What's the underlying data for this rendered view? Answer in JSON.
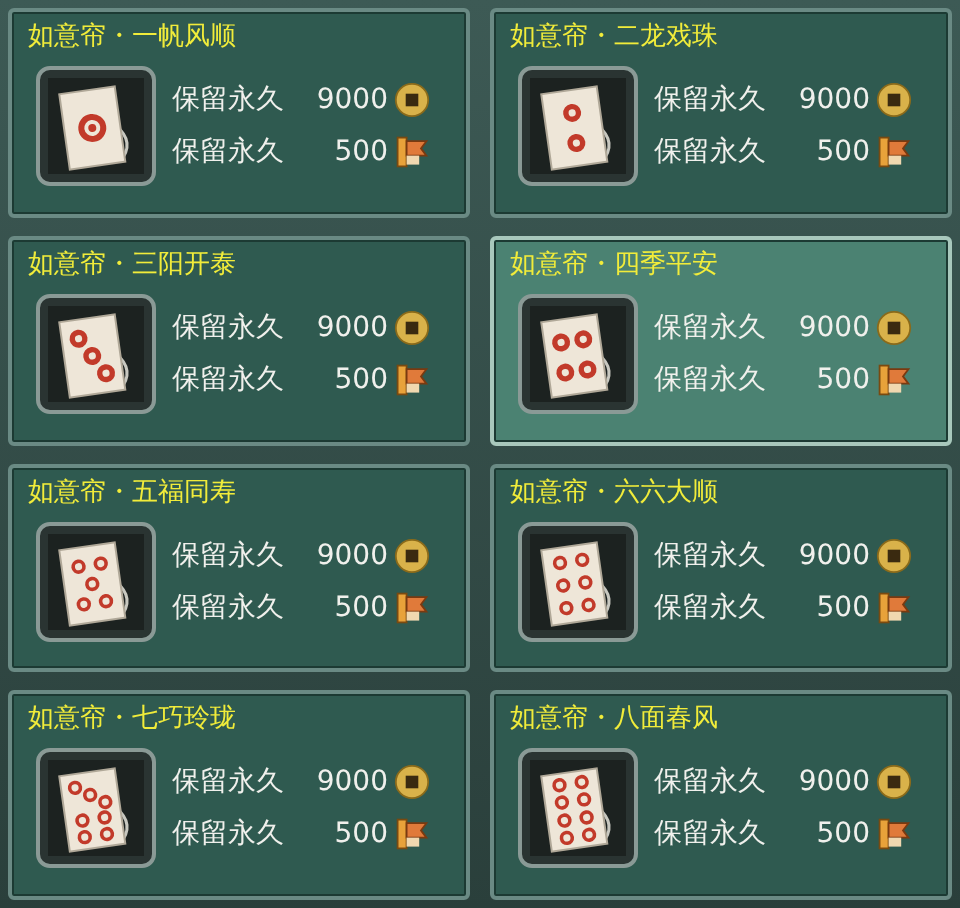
{
  "items": [
    {
      "title": "如意帘・一帆风顺",
      "selected": false,
      "prices": [
        {
          "label": "保留永久",
          "amount": "9000",
          "kind": "coin"
        },
        {
          "label": "保留永久",
          "amount": "500",
          "kind": "token"
        }
      ]
    },
    {
      "title": "如意帘・二龙戏珠",
      "selected": false,
      "prices": [
        {
          "label": "保留永久",
          "amount": "9000",
          "kind": "coin"
        },
        {
          "label": "保留永久",
          "amount": "500",
          "kind": "token"
        }
      ]
    },
    {
      "title": "如意帘・三阳开泰",
      "selected": false,
      "prices": [
        {
          "label": "保留永久",
          "amount": "9000",
          "kind": "coin"
        },
        {
          "label": "保留永久",
          "amount": "500",
          "kind": "token"
        }
      ]
    },
    {
      "title": "如意帘・四季平安",
      "selected": true,
      "prices": [
        {
          "label": "保留永久",
          "amount": "9000",
          "kind": "coin"
        },
        {
          "label": "保留永久",
          "amount": "500",
          "kind": "token"
        }
      ]
    },
    {
      "title": "如意帘・五福同寿",
      "selected": false,
      "prices": [
        {
          "label": "保留永久",
          "amount": "9000",
          "kind": "coin"
        },
        {
          "label": "保留永久",
          "amount": "500",
          "kind": "token"
        }
      ]
    },
    {
      "title": "如意帘・六六大顺",
      "selected": false,
      "prices": [
        {
          "label": "保留永久",
          "amount": "9000",
          "kind": "coin"
        },
        {
          "label": "保留永久",
          "amount": "500",
          "kind": "token"
        }
      ]
    },
    {
      "title": "如意帘・七巧玲珑",
      "selected": false,
      "prices": [
        {
          "label": "保留永久",
          "amount": "9000",
          "kind": "coin"
        },
        {
          "label": "保留永久",
          "amount": "500",
          "kind": "token"
        }
      ]
    },
    {
      "title": "如意帘・八面春风",
      "selected": false,
      "prices": [
        {
          "label": "保留永久",
          "amount": "9000",
          "kind": "coin"
        },
        {
          "label": "保留永久",
          "amount": "500",
          "kind": "token"
        }
      ]
    }
  ]
}
